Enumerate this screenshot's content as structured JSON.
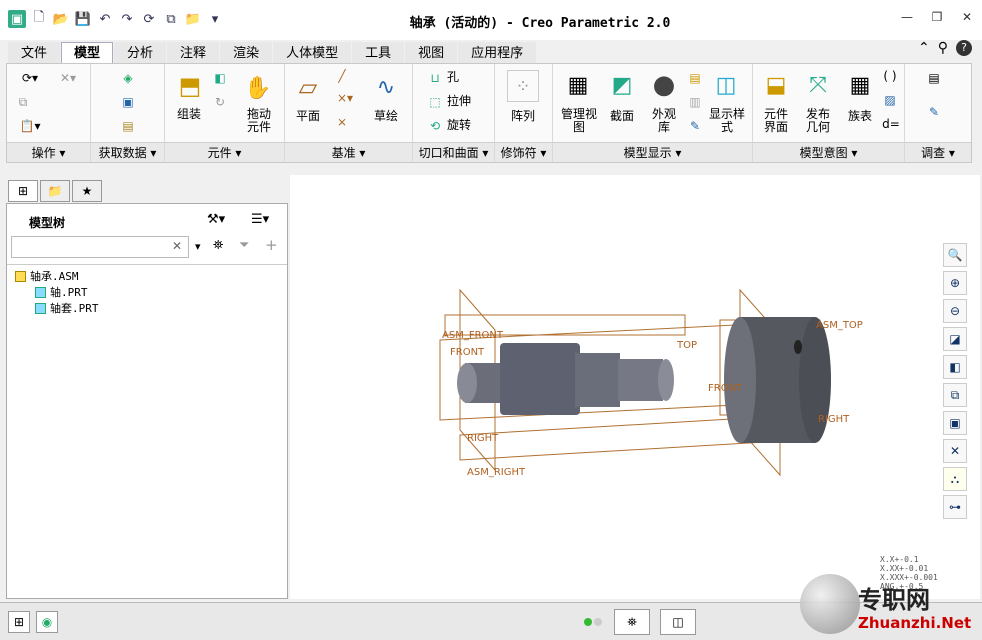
{
  "title": "轴承 (活动的) - Creo Parametric 2.0",
  "tabs": [
    "文件",
    "模型",
    "分析",
    "注释",
    "渲染",
    "人体模型",
    "工具",
    "视图",
    "应用程序"
  ],
  "active_tab": "模型",
  "ribbon": {
    "groups": [
      "操作",
      "获取数据",
      "元件",
      "基准",
      "切口和曲面",
      "修饰符",
      "模型显示",
      "模型意图",
      "调查"
    ],
    "buttons": {
      "assemble": "组装",
      "drag": "拖动\n元件",
      "plane": "平面",
      "sketch": "草绘",
      "hole": "孔",
      "extrude": "拉伸",
      "revolve": "旋转",
      "pattern": "阵列",
      "manage_views": "管理视\n图",
      "section": "截面",
      "appearance": "外观\n库",
      "display_style": "显示样\n式",
      "component_interface": "元件\n界面",
      "publish_geometry": "发布\n几何",
      "family_table": "族表",
      "d_equals": "d="
    }
  },
  "model_tree": {
    "title": "模型树",
    "search_value": "",
    "items": [
      {
        "label": "轴承.ASM"
      },
      {
        "label": "轴.PRT"
      },
      {
        "label": "轴套.PRT"
      }
    ]
  },
  "datum_labels": [
    "ASM_FRONT",
    "FRONT",
    "TOP",
    "ASM_TOP",
    "RIGHT",
    "ASM_RIGHT",
    "RIGHT",
    "FRONT"
  ],
  "tolerance": {
    "l1": "X.X+-0.1",
    "l2": "X.XX+-0.01",
    "l3": "X.XXX+-0.001",
    "l4": "ANG.+-0.5"
  },
  "watermark": {
    "text1": "专职网",
    "text2": "Zhuanzhi.Net"
  }
}
